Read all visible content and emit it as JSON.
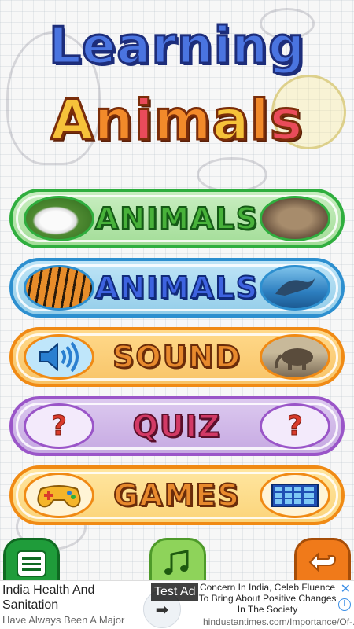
{
  "title": {
    "line1": "Learning",
    "line2_letters": [
      "A",
      "n",
      "i",
      "m",
      "a",
      "l",
      "s"
    ]
  },
  "menu": [
    {
      "label": "ANIMALS",
      "left_icon": "rabbit-photo",
      "right_icon": "cat-photo",
      "color": "#2fae3e"
    },
    {
      "label": "ANIMALS",
      "left_icon": "tiger-photo",
      "right_icon": "dolphin-photo",
      "color": "#2d8fcf"
    },
    {
      "label": "SOUND",
      "left_icon": "speaker-icon",
      "right_icon": "elephant-photo",
      "color": "#f08a14"
    },
    {
      "label": "QUIZ",
      "left_icon": "question-icon",
      "right_icon": "question-icon",
      "left_glyph": "?",
      "right_glyph": "?",
      "color": "#9a55c8"
    },
    {
      "label": "GAMES",
      "left_icon": "gamepad-icon",
      "right_icon": "grid-icon",
      "color": "#f08a14"
    }
  ],
  "bottom_buttons": {
    "menu_icon": "menu-icon",
    "music_icon": "music-icon",
    "back_icon": "back-arrow-icon"
  },
  "ad": {
    "test_label": "Test Ad",
    "headline": "India Health And Sanitation",
    "subtitle": "Have Always Been A Major",
    "right_text": "Concern In India, Celeb Fluence To Bring About Positive Changes In The Society",
    "url": "hindustantimes.com/Importance/Of-...",
    "arrow": "➡",
    "close": "✕",
    "info": "i"
  }
}
